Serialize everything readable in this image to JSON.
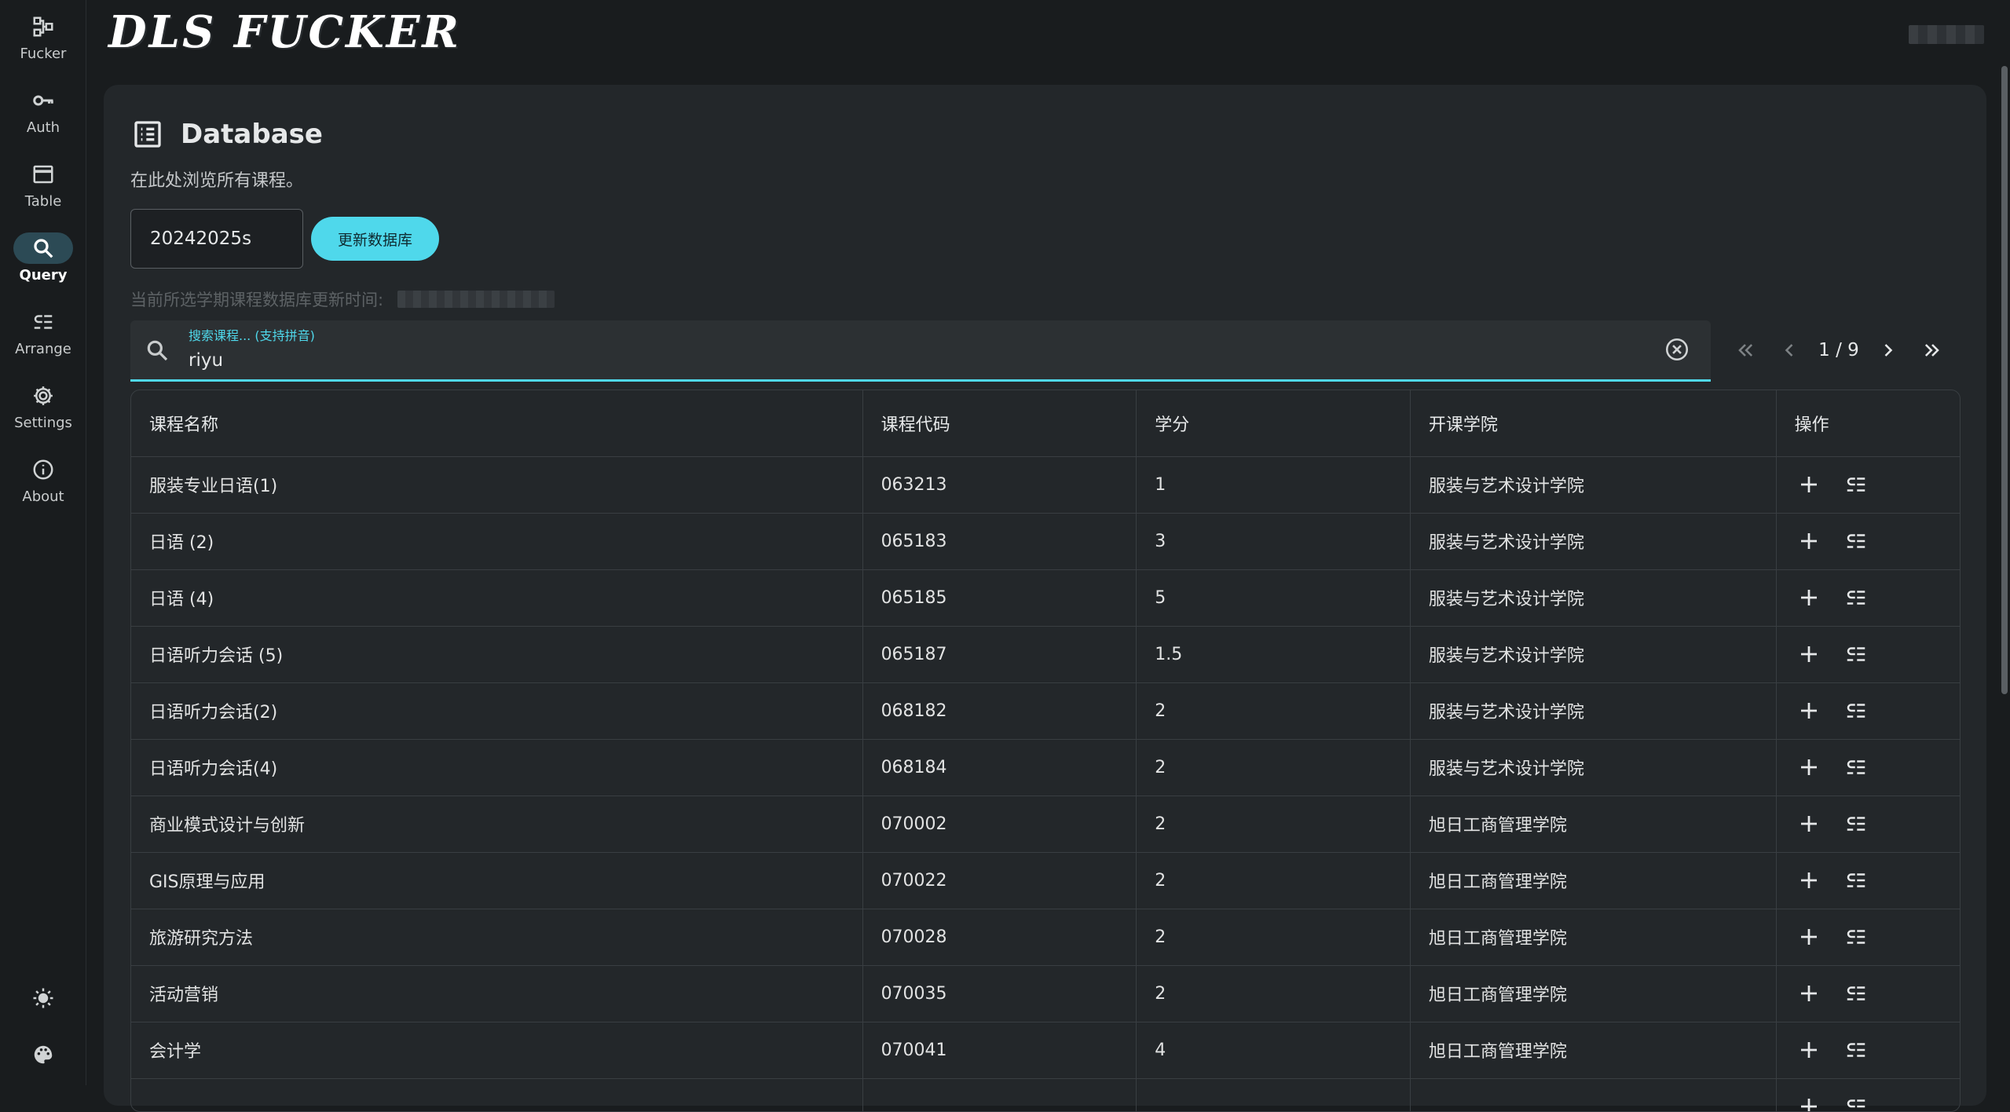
{
  "app": {
    "logo_text": "DLS FUCKER"
  },
  "sidebar": {
    "items": [
      {
        "label": "Fucker",
        "icon": "flowchart-icon"
      },
      {
        "label": "Auth",
        "icon": "key-icon"
      },
      {
        "label": "Table",
        "icon": "window-icon"
      },
      {
        "label": "Query",
        "icon": "search-icon",
        "active": true
      },
      {
        "label": "Arrange",
        "icon": "arrange-icon"
      },
      {
        "label": "Settings",
        "icon": "gear-icon"
      },
      {
        "label": "About",
        "icon": "info-icon"
      }
    ],
    "bottom": [
      {
        "icon": "sun-icon"
      },
      {
        "icon": "palette-icon"
      }
    ]
  },
  "page": {
    "title": "Database",
    "subtitle": "在此处浏览所有课程。",
    "semester_value": "20242025s",
    "update_button": "更新数据库",
    "update_note": "当前所选学期课程数据库更新时间:"
  },
  "search": {
    "label": "搜索课程... (支持拼音)",
    "value": "riyu"
  },
  "pagination": {
    "text": "1 / 9"
  },
  "table": {
    "headers": [
      "课程名称",
      "课程代码",
      "学分",
      "开课学院",
      "操作"
    ],
    "rows": [
      [
        "服装专业日语(1)",
        "063213",
        "1",
        "服装与艺术设计学院"
      ],
      [
        "日语 (2)",
        "065183",
        "3",
        "服装与艺术设计学院"
      ],
      [
        "日语 (4)",
        "065185",
        "5",
        "服装与艺术设计学院"
      ],
      [
        "日语听力会话 (5)",
        "065187",
        "1.5",
        "服装与艺术设计学院"
      ],
      [
        "日语听力会话(2)",
        "068182",
        "2",
        "服装与艺术设计学院"
      ],
      [
        "日语听力会话(4)",
        "068184",
        "2",
        "服装与艺术设计学院"
      ],
      [
        "商业模式设计与创新",
        "070002",
        "2",
        "旭日工商管理学院"
      ],
      [
        "GIS原理与应用",
        "070022",
        "2",
        "旭日工商管理学院"
      ],
      [
        "旅游研究方法",
        "070028",
        "2",
        "旭日工商管理学院"
      ],
      [
        "活动营销",
        "070035",
        "2",
        "旭日工商管理学院"
      ],
      [
        "会计学",
        "070041",
        "4",
        "旭日工商管理学院"
      ],
      [
        "",
        "",
        "",
        ""
      ]
    ]
  },
  "colors": {
    "accent": "#4fd8eb",
    "background": "#191c1e",
    "card": "#23272a"
  }
}
